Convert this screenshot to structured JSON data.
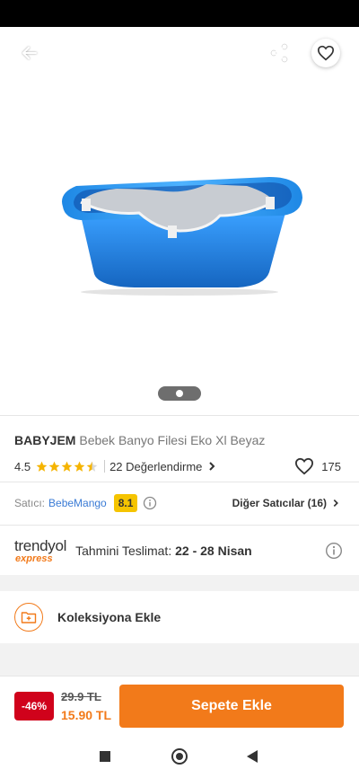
{
  "product": {
    "brand": "BABYJEM",
    "name": "Bebek Banyo Filesi Eko Xl Beyaz",
    "rating": "4.5",
    "review_text": "22 Değerlendirme",
    "favorite_count": "175",
    "image_icon": "baby-bath-tub-image"
  },
  "seller": {
    "label": "Satıcı:",
    "name": "BebeMango",
    "score": "8.1",
    "other_sellers": "Diğer Satıcılar (16)"
  },
  "delivery": {
    "logo_main": "trendyol",
    "logo_sub": "express",
    "label": "Tahmini Teslimat:",
    "dates": "22 - 28 Nisan"
  },
  "collection": {
    "label": "Koleksiyona Ekle"
  },
  "pricing": {
    "discount": "-46%",
    "old_price": "29.9 TL",
    "new_price": "15.90 TL",
    "cart_button": "Sepete Ekle"
  },
  "colors": {
    "accent": "#f27a1a",
    "discount_red": "#d0021b",
    "seller_score_bg": "#f5c400",
    "link_blue": "#3a7bd5"
  },
  "icons": [
    "back-arrow-icon",
    "share-icon",
    "heart-icon",
    "info-icon",
    "chevron-right-icon",
    "folder-plus-icon",
    "star-icon"
  ]
}
